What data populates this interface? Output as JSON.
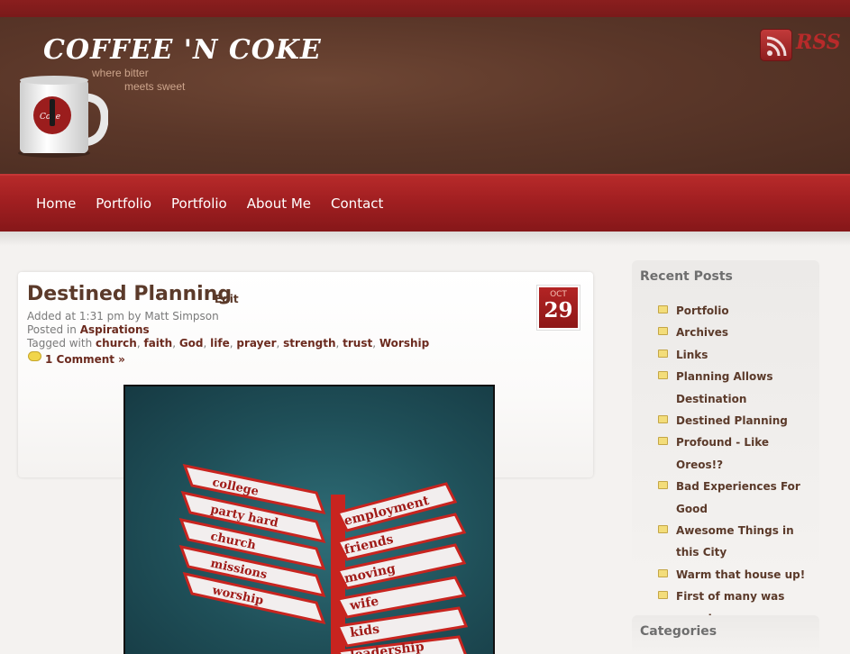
{
  "site": {
    "title": "COFFEE 'N COKE",
    "tagline_line1": "where bitter",
    "tagline_line2": "meets sweet",
    "rss_label": "RSS"
  },
  "nav": {
    "items": [
      "Home",
      "Portfolio",
      "Portfolio",
      "About Me",
      "Contact"
    ]
  },
  "post": {
    "title": "Destined Planning",
    "edit_label": "Edit",
    "added_line": "Added at 1:31 pm by Matt Simpson",
    "posted_in_label": "Posted in",
    "category": "Aspirations",
    "tagged_label": "Tagged with",
    "tags": [
      "church",
      "faith",
      "God",
      "life",
      "prayer",
      "strength",
      "trust",
      "Worship"
    ],
    "comments": "1 Comment »",
    "date_month": "OCT",
    "date_day": "29",
    "image_signs_left": [
      "college",
      "party hard",
      "church",
      "missions",
      "worship"
    ],
    "image_signs_right": [
      "employment",
      "friends",
      "moving",
      "wife",
      "kids",
      "leadership"
    ]
  },
  "sidebar": {
    "recent_title": "Recent Posts",
    "recent_posts": [
      "Portfolio",
      "Archives",
      "Links",
      "Planning Allows Destination",
      "Destined Planning",
      "Profound - Like Oreos!?",
      "Bad Experiences For Good",
      "Awesome Things in this City",
      "Warm that house up!",
      "First of many was amazing"
    ],
    "categories_title": "Categories"
  },
  "colors": {
    "brand_red": "#a11f21",
    "header_brown": "#5b3729",
    "link_brown": "#5b3a2a"
  }
}
